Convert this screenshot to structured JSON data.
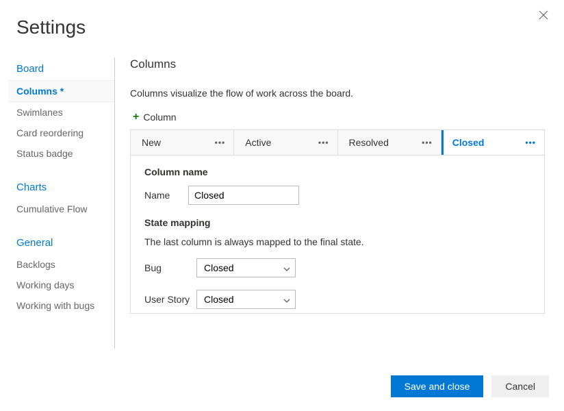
{
  "dialog": {
    "title": "Settings",
    "close_label": "Close"
  },
  "sidebar": {
    "groups": [
      {
        "title": "Board",
        "items": [
          {
            "label": "Columns *",
            "active": true
          },
          {
            "label": "Swimlanes"
          },
          {
            "label": "Card reordering"
          },
          {
            "label": "Status badge"
          }
        ]
      },
      {
        "title": "Charts",
        "items": [
          {
            "label": "Cumulative Flow"
          }
        ]
      },
      {
        "title": "General",
        "items": [
          {
            "label": "Backlogs"
          },
          {
            "label": "Working days"
          },
          {
            "label": "Working with bugs"
          }
        ]
      }
    ]
  },
  "main": {
    "heading": "Columns",
    "description": "Columns visualize the flow of work across the board.",
    "add_column_label": "Column",
    "tabs": [
      {
        "label": "New"
      },
      {
        "label": "Active"
      },
      {
        "label": "Resolved"
      },
      {
        "label": "Closed",
        "active": true
      }
    ],
    "column_name_section": {
      "title": "Column name",
      "name_label": "Name",
      "name_value": "Closed"
    },
    "state_mapping_section": {
      "title": "State mapping",
      "help": "The last column is always mapped to the final state.",
      "bug_label": "Bug",
      "bug_value": "Closed",
      "user_story_label": "User Story",
      "user_story_value": "Closed"
    }
  },
  "footer": {
    "save_label": "Save and close",
    "cancel_label": "Cancel"
  }
}
